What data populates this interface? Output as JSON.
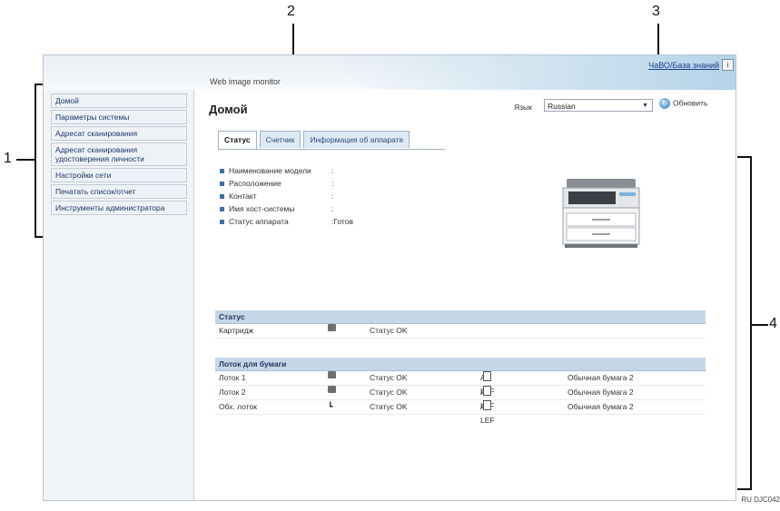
{
  "callouts": [
    "1",
    "2",
    "3",
    "4"
  ],
  "ref_code": "RU DJC042",
  "header": {
    "brand": "Web image monitor",
    "faq_link": "ЧаВО/База знаний",
    "info_icon": "i"
  },
  "sidebar": {
    "items": [
      {
        "label": "Домой"
      },
      {
        "label": "Параметры системы"
      },
      {
        "label": "Адресат сканирования"
      },
      {
        "label": "Адресат сканирования удостоверения личности"
      },
      {
        "label": "Настройки сети"
      },
      {
        "label": "Печатать список/отчет"
      },
      {
        "label": "Инструменты администратора"
      }
    ]
  },
  "main": {
    "title": "Домой",
    "language_label": "Язык",
    "language_value": "Russian",
    "refresh_label": "Обновить",
    "tabs": [
      {
        "label": "Статус",
        "active": true
      },
      {
        "label": "Счетчик",
        "active": false
      },
      {
        "label": "Информация об аппарате",
        "active": false
      }
    ],
    "device_info": [
      {
        "label": "Наименование модели",
        "value": ":"
      },
      {
        "label": "Расположение",
        "value": ":"
      },
      {
        "label": "Контакт",
        "value": ":"
      },
      {
        "label": "Имя хост-системы",
        "value": ":"
      },
      {
        "label": "Статус аппарата",
        "value": ":Готов"
      }
    ],
    "status_section": {
      "title": "Статус",
      "rows": [
        {
          "name": "Картридж",
          "icon": "toner-icon",
          "status": "Статус OK"
        }
      ]
    },
    "paper_section": {
      "title": "Лоток для бумаги",
      "rows": [
        {
          "name": "Лоток 1",
          "icon": "tray-icon",
          "status": "Статус OK",
          "size": "A4 LEF",
          "type": "Обычная бумага 2"
        },
        {
          "name": "Лоток 2",
          "icon": "tray-icon",
          "status": "Статус OK",
          "size": "A4 LEF",
          "type": "Обычная бумага 2"
        },
        {
          "name": "Обх. лоток",
          "icon": "bypass-tray-icon",
          "status": "Статус OK",
          "size": "A4 LEF",
          "type": "Обычная бумага 2"
        }
      ]
    }
  },
  "colors": {
    "accent": "#3f6fa8",
    "section_header": "#c5d6e7",
    "link": "#1a3e8c"
  }
}
